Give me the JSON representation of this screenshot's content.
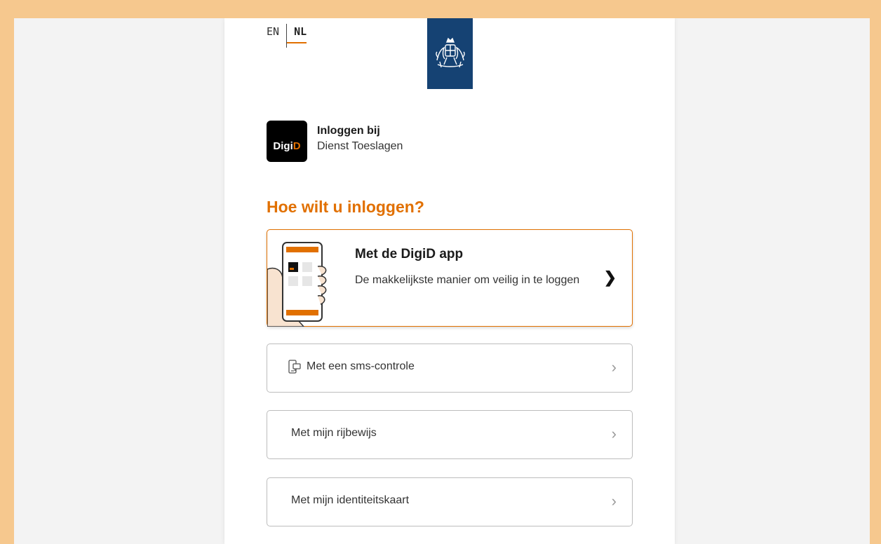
{
  "language": {
    "options": [
      "EN",
      "NL"
    ],
    "active": "NL"
  },
  "brand": {
    "ribbon_color": "#154273",
    "accent_color": "#e17000",
    "digid_logo": {
      "part1": "Digi",
      "part2": "D"
    }
  },
  "header": {
    "line1": "Inloggen bij",
    "line2": "Dienst Toeslagen"
  },
  "main": {
    "heading": "Hoe wilt u inloggen?",
    "app_option": {
      "title": "Met de DigiD app",
      "description": "De makkelijkste manier om veilig in te loggen",
      "icon": "chevron-right-icon"
    },
    "options": [
      {
        "label": "Met een sms-controle",
        "icon": "phone-sms-icon"
      },
      {
        "label": "Met mijn rijbewijs",
        "icon": ""
      },
      {
        "label": "Met mijn identiteitskaart",
        "icon": ""
      }
    ]
  }
}
